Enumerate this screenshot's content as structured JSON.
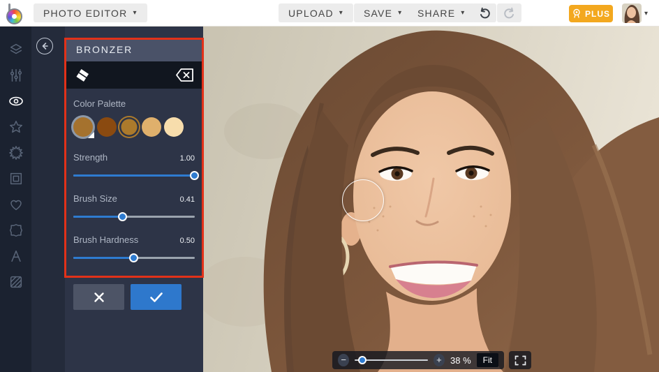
{
  "topbar": {
    "photo_editor_label": "PHOTO EDITOR",
    "upload_label": "UPLOAD",
    "save_label": "SAVE",
    "share_label": "SHARE",
    "plus_label": "PLUS",
    "caret": "▾"
  },
  "sidebar": {
    "icons": [
      "layers",
      "edit-adjust",
      "touch-up-eye",
      "effects-star",
      "artsy-flower",
      "frames",
      "graphics-heart",
      "overlays-badge",
      "text",
      "textures"
    ],
    "active": "touch-up-eye"
  },
  "panel": {
    "title": "BRONZER",
    "tool_icons": [
      "eraser",
      "clear-backspace"
    ],
    "color_palette_label": "Color Palette",
    "swatches": [
      "#a5722e",
      "#8a4a10",
      "#ab7a2c",
      "#dfb06c",
      "#f7ddac"
    ],
    "selected_swatch_index": 2,
    "sliders": [
      {
        "label": "Strength",
        "value": "1.00",
        "percent": 100
      },
      {
        "label": "Brush Size",
        "value": "0.41",
        "percent": 41
      },
      {
        "label": "Brush Hardness",
        "value": "0.50",
        "percent": 50
      }
    ]
  },
  "zoombar": {
    "zoom_text": "38 %",
    "fit_label": "Fit",
    "slider_percent": 10
  },
  "colors": {
    "accent_blue": "#2e7bd0",
    "annotation_red": "#e23119",
    "plus_orange": "#f3a81f",
    "panel_bg": "#2d3447",
    "sidebar_bg": "#1b2230"
  }
}
